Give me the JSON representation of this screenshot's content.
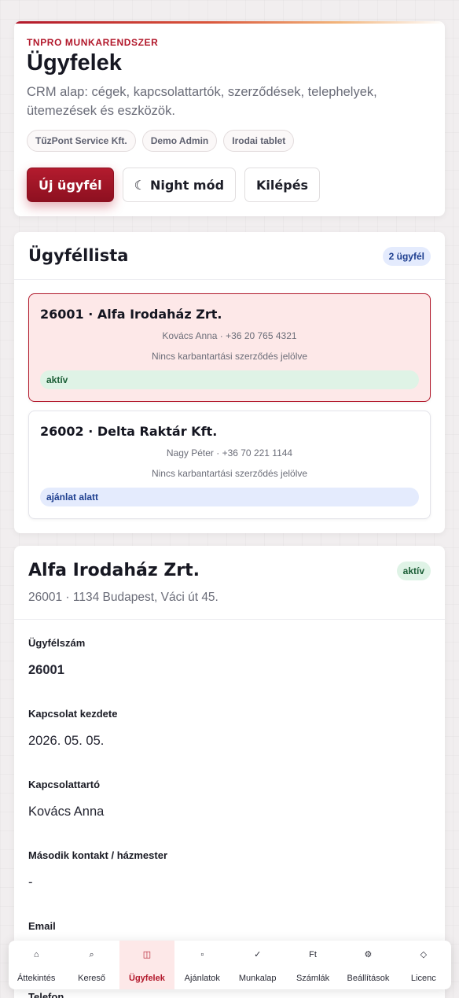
{
  "header": {
    "eyebrow": "TNPRO MUNKARENDSZER",
    "title": "Ügyfelek",
    "subtitle": "CRM alap: cégek, kapcsolattartók, szerződések, telephelyek, ütemezések és eszközök.",
    "chips": [
      "TűzPont Service Kft.",
      "Demo Admin",
      "Irodai tablet"
    ],
    "buttons": {
      "new_client": "Új ügyfél",
      "night_icon": "☾",
      "night_mode": "Night mód",
      "logout": "Kilépés"
    }
  },
  "client_list": {
    "title": "Ügyféllista",
    "count": "2 ügyfél",
    "items": [
      {
        "title": "26001 · Alfa Irodaház Zrt.",
        "contact": "Kovács Anna · +36 20 765 4321",
        "contract": "Nincs karbantartási szerződés jelölve",
        "status": "aktív"
      },
      {
        "title": "26002 · Delta Raktár Kft.",
        "contact": "Nagy Péter · +36 70 221 1144",
        "contract": "Nincs karbantartási szerződés jelölve",
        "status": "ajánlat alatt"
      }
    ]
  },
  "detail": {
    "name": "Alfa Irodaház Zrt.",
    "status": "aktív",
    "subline": "26001 · 1134 Budapest, Váci út 45.",
    "fields": [
      {
        "label": "Ügyfélszám",
        "value": "26001"
      },
      {
        "label": "Kapcsolat kezdete",
        "value": "2026. 05. 05."
      },
      {
        "label": "Kapcsolattartó",
        "value": "Kovács Anna"
      },
      {
        "label": "Második kontakt / házmester",
        "value": "-"
      },
      {
        "label": "Email",
        "value": ""
      },
      {
        "label": "Telefon",
        "value": ""
      }
    ]
  },
  "nav": {
    "items": [
      {
        "icon": "⌂",
        "icon_name": "home-icon",
        "label": "Áttekintés"
      },
      {
        "icon": "⌕",
        "icon_name": "search-icon",
        "label": "Kereső"
      },
      {
        "icon": "◫",
        "icon_name": "clients-icon",
        "label": "Ügyfelek"
      },
      {
        "icon": "▫",
        "icon_name": "offers-icon",
        "label": "Ajánlatok"
      },
      {
        "icon": "✓",
        "icon_name": "check-icon",
        "label": "Munkalap"
      },
      {
        "icon": "Ft",
        "icon_name": "invoice-icon",
        "label": "Számlák"
      },
      {
        "icon": "⚙",
        "icon_name": "settings-icon",
        "label": "Beállítások"
      },
      {
        "icon": "◇",
        "icon_name": "license-icon",
        "label": "Licenc"
      }
    ],
    "active": "Ügyfelek"
  },
  "colors": {
    "brand": "#b2182b",
    "active_green_bg": "#dff3e6",
    "blue_badge_bg": "#e4ebfd"
  }
}
